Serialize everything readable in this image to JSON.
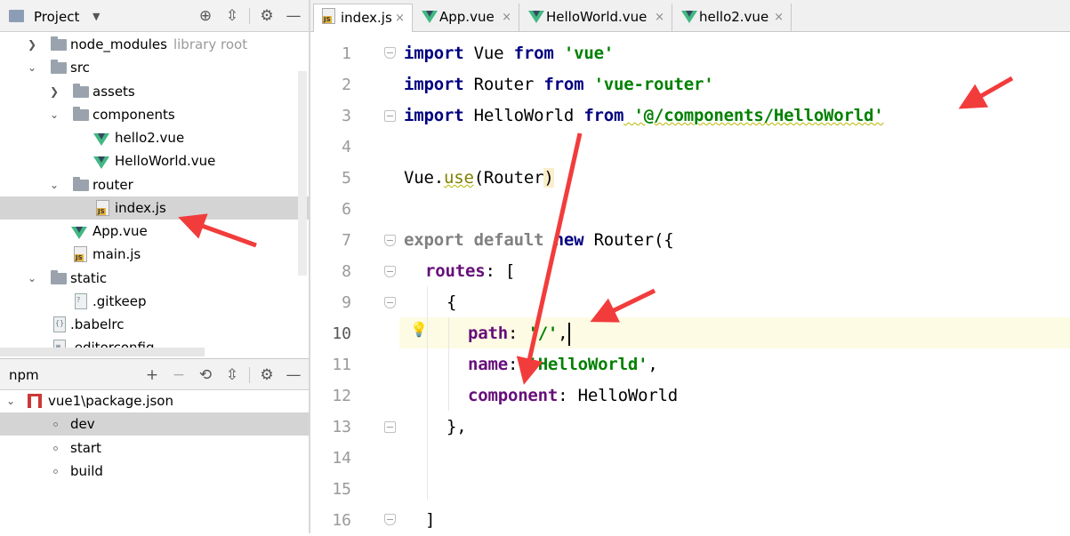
{
  "project_panel": {
    "title": "Project",
    "dropdown_icon": "caret-down-icon",
    "header_icons": [
      "target-icon",
      "collapse-all-icon",
      "gear-icon",
      "minimize-icon"
    ],
    "tree": [
      {
        "label": "node_modules",
        "hint": "library root",
        "type": "folder",
        "expanded": false
      },
      {
        "label": "src",
        "type": "folder",
        "expanded": true
      },
      {
        "label": "assets",
        "type": "folder",
        "expanded": false
      },
      {
        "label": "components",
        "type": "folder",
        "expanded": true
      },
      {
        "label": "hello2.vue",
        "type": "vue"
      },
      {
        "label": "HelloWorld.vue",
        "type": "vue"
      },
      {
        "label": "router",
        "type": "folder",
        "expanded": true
      },
      {
        "label": "index.js",
        "type": "js",
        "selected": true
      },
      {
        "label": "App.vue",
        "type": "vue"
      },
      {
        "label": "main.js",
        "type": "js"
      },
      {
        "label": "static",
        "type": "folder",
        "expanded": true
      },
      {
        "label": ".gitkeep",
        "type": "file"
      },
      {
        "label": ".babelrc",
        "type": "file"
      },
      {
        "label": ".editorconfig",
        "type": "file"
      }
    ]
  },
  "npm_panel": {
    "title": "npm",
    "header_icons": [
      "add-icon",
      "remove-icon",
      "refresh-icon",
      "collapse-icon",
      "gear-icon",
      "minimize-icon"
    ],
    "package": "vue1\\package.json",
    "scripts": [
      {
        "label": "dev",
        "selected": true
      },
      {
        "label": "start"
      },
      {
        "label": "build"
      }
    ]
  },
  "tabs": [
    {
      "label": "index.js",
      "type": "js",
      "active": true
    },
    {
      "label": "App.vue",
      "type": "vue"
    },
    {
      "label": "HelloWorld.vue",
      "type": "vue"
    },
    {
      "label": "hello2.vue",
      "type": "vue"
    }
  ],
  "tab_close_glyph": "×",
  "line_numbers": [
    "1",
    "2",
    "3",
    "4",
    "5",
    "6",
    "7",
    "8",
    "9",
    "10",
    "11",
    "12",
    "13",
    "14",
    "15",
    "16"
  ],
  "current_line": 10,
  "code": {
    "l1": {
      "kw1": "import",
      "id": " Vue ",
      "kw2": "from",
      "str": " 'vue'"
    },
    "l2": {
      "kw1": "import",
      "id": " Router ",
      "kw2": "from",
      "str": " 'vue-router'"
    },
    "l3": {
      "kw1": "import",
      "id": " HelloWorld ",
      "kw2": "from",
      "str": " '@/components/HelloWorld'"
    },
    "l5": {
      "obj": "Vue.",
      "fn": "use",
      "args": "(Router",
      "close": ")"
    },
    "l7": {
      "kw1": "export default",
      "kw2": " new ",
      "rest": "Router({"
    },
    "l8": {
      "prop": "routes",
      "rest": ": ["
    },
    "l9": {
      "text": "{"
    },
    "l10": {
      "prop": "path",
      "colon": ": ",
      "str": "'/'",
      "comma": ","
    },
    "l11": {
      "prop": "name",
      "colon": ": ",
      "str": "'HelloWorld'",
      "comma": ","
    },
    "l12": {
      "prop": "component",
      "colon": ": ",
      "rest": "HelloWorld"
    },
    "l13": {
      "text": "},"
    },
    "l16": {
      "text": "]"
    }
  },
  "colors": {
    "keyword": "#000080",
    "string": "#008000",
    "property": "#660e7a",
    "arrow": "#f23c3c",
    "selection": "#d4d4d4",
    "current_line": "#fdfbe4"
  }
}
